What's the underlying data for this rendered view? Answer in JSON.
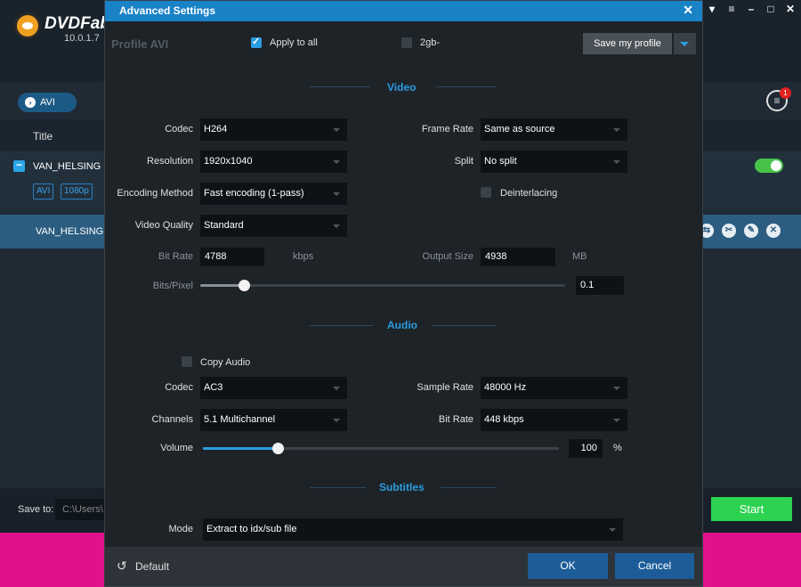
{
  "app": {
    "brand": "DVDFab",
    "version": "10.0.1.7",
    "profile_pill": "AVI",
    "title_column": "Title",
    "title_name": "VAN_HELSING",
    "tags": [
      "AVI",
      "1080p"
    ],
    "row2_title": "VAN_HELSING",
    "save_to_label": "Save to:",
    "save_path": "C:\\Users\\",
    "start_label": "Start",
    "notification_count": "1",
    "window_controls": [
      "▾",
      "≡",
      "–",
      "□",
      "✕"
    ],
    "row_icons": [
      "⇆",
      "✂",
      "✎",
      "✕"
    ]
  },
  "dialog": {
    "title": "Advanced Settings",
    "close_glyph": "✕",
    "profile_label": "Profile  AVI",
    "apply_to_all": {
      "label": "Apply to all",
      "checked": true
    },
    "twogb": {
      "label": "2gb-",
      "checked": false
    },
    "save_profile_label": "Save my profile",
    "sections": {
      "video": "Video",
      "audio": "Audio",
      "subtitles": "Subtitles"
    },
    "video": {
      "codec_label": "Codec",
      "codec": "H264",
      "frame_rate_label": "Frame Rate",
      "frame_rate": "Same as source",
      "resolution_label": "Resolution",
      "resolution": "1920x1040",
      "split_label": "Split",
      "split": "No split",
      "encoding_label": "Encoding Method",
      "encoding": "Fast encoding (1-pass)",
      "deinterlacing_label": "Deinterlacing",
      "deinterlacing": false,
      "quality_label": "Video Quality",
      "quality": "Standard",
      "bitrate_label": "Bit Rate",
      "bitrate": "4788",
      "bitrate_unit": "kbps",
      "output_size_label": "Output Size",
      "output_size": "4938",
      "output_size_unit": "MB",
      "bits_pixel_label": "Bits/Pixel",
      "bits_pixel": "0.1",
      "bits_pixel_fraction": 0.12
    },
    "audio": {
      "copy_label": "Copy Audio",
      "copy": false,
      "codec_label": "Codec",
      "codec": "AC3",
      "sample_rate_label": "Sample Rate",
      "sample_rate": "48000 Hz",
      "channels_label": "Channels",
      "channels": "5.1 Multichannel",
      "bitrate_label": "Bit Rate",
      "bitrate": "448 kbps",
      "volume_label": "Volume",
      "volume": "100",
      "volume_unit": "%",
      "volume_fraction": 0.21
    },
    "subtitles": {
      "mode_label": "Mode",
      "mode": "Extract to idx/sub file"
    },
    "footer": {
      "default_label": "Default",
      "ok_label": "OK",
      "cancel_label": "Cancel"
    }
  },
  "colors": {
    "accent": "#2b9ce0",
    "title_bar": "#1a82c7",
    "start_green": "#2cd351",
    "strip": "#e0118b"
  }
}
